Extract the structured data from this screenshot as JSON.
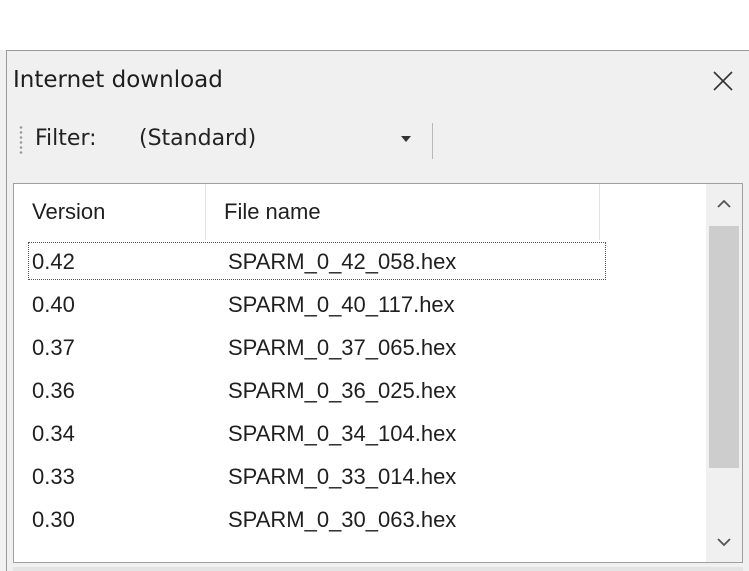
{
  "dialog": {
    "title": "Internet download",
    "close_icon": "close-icon"
  },
  "toolbar": {
    "filter_label": "Filter:",
    "filter_value": "(Standard)"
  },
  "table": {
    "columns": [
      "Version",
      "File name"
    ],
    "rows": [
      {
        "version": "0.42",
        "file": "SPARM_0_42_058.hex"
      },
      {
        "version": "0.40",
        "file": "SPARM_0_40_117.hex"
      },
      {
        "version": "0.37",
        "file": "SPARM_0_37_065.hex"
      },
      {
        "version": "0.36",
        "file": "SPARM_0_36_025.hex"
      },
      {
        "version": "0.34",
        "file": "SPARM_0_34_104.hex"
      },
      {
        "version": "0.33",
        "file": "SPARM_0_33_014.hex"
      },
      {
        "version": "0.30",
        "file": "SPARM_0_30_063.hex"
      }
    ]
  },
  "scrollbar": {
    "up_icon": "chevron-up-icon",
    "down_icon": "chevron-down-icon"
  }
}
